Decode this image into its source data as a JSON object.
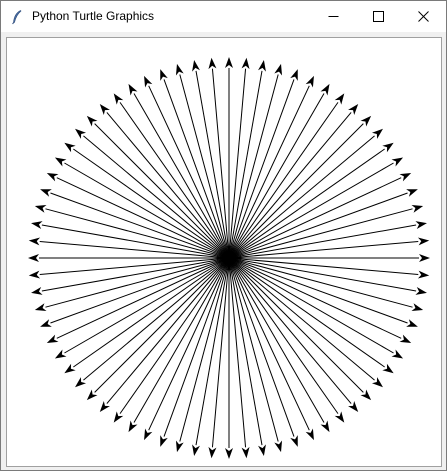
{
  "window": {
    "title": "Python Turtle Graphics",
    "app_icon": "feather-icon",
    "controls": [
      {
        "name": "minimize",
        "icon": "minimize-icon"
      },
      {
        "name": "maximize",
        "icon": "maximize-icon"
      },
      {
        "name": "close",
        "icon": "close-icon"
      }
    ]
  },
  "drawing": {
    "background_color": "#ffffff",
    "pen_color": "#000000",
    "ray_count": 72,
    "angle_step_degrees": 5,
    "arrowhead": "classic"
  }
}
